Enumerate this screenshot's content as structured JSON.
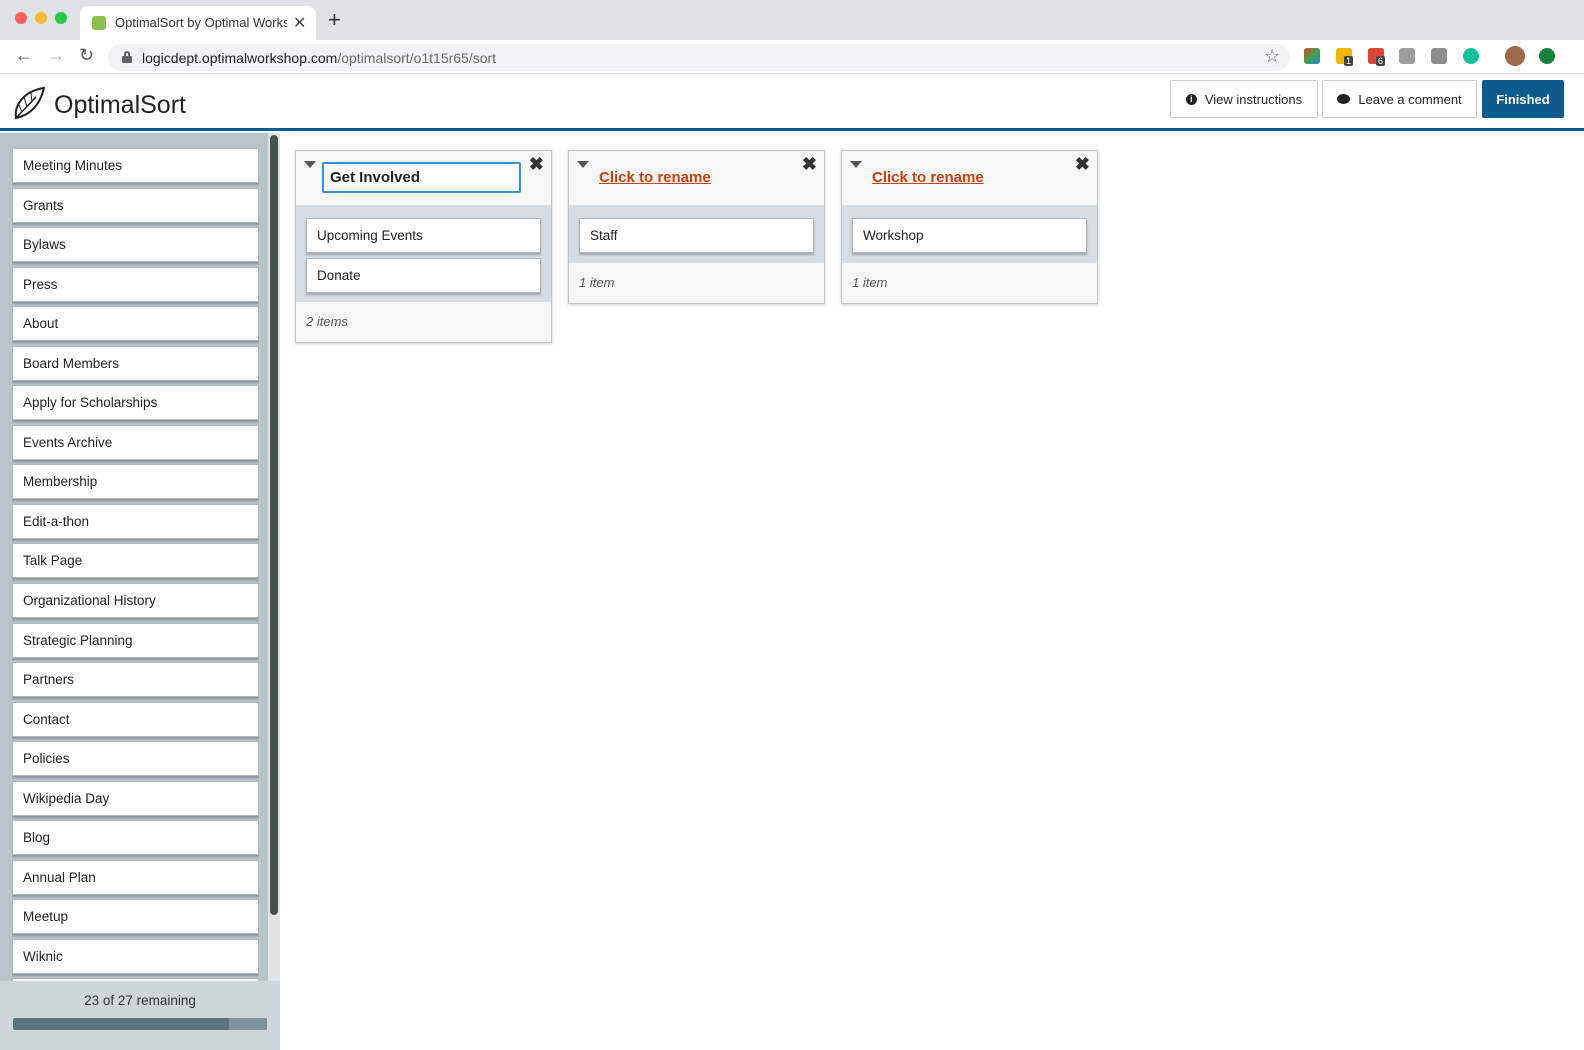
{
  "browser": {
    "tab_title": "OptimalSort by Optimal Workshop",
    "url_domain": "logicdept.optimalworkshop.com",
    "url_path": "/optimalsort/o1t15r65/sort",
    "ext_badge_1": "1",
    "ext_badge_2": "6"
  },
  "header": {
    "logo": "OptimalSort",
    "view_instructions": "View instructions",
    "leave_comment": "Leave a comment",
    "finished": "Finished",
    "accent_color": "#0b5b8f"
  },
  "sidebar": {
    "cards": [
      "Meeting Minutes",
      "Grants",
      "Bylaws",
      "Press",
      "About",
      "Board Members",
      "Apply for Scholarships",
      "Events Archive",
      "Membership",
      "Edit-a-thon",
      "Talk Page",
      "Organizational History",
      "Strategic Planning",
      "Partners",
      "Contact",
      "Policies",
      "Wikipedia Day",
      "Blog",
      "Annual Plan",
      "Meetup",
      "Wiknic",
      ""
    ],
    "remaining": "23 of 27 remaining",
    "sorted_fraction": 0.148
  },
  "groups": [
    {
      "name": "Get Involved",
      "cards": [
        "Upcoming Events",
        "Donate"
      ],
      "count": "2 items"
    },
    {
      "name": "Click to rename",
      "cards": [
        "Staff"
      ],
      "count": "1 item"
    },
    {
      "name": "Click to rename",
      "cards": [
        "Workshop"
      ],
      "count": "1 item"
    }
  ]
}
